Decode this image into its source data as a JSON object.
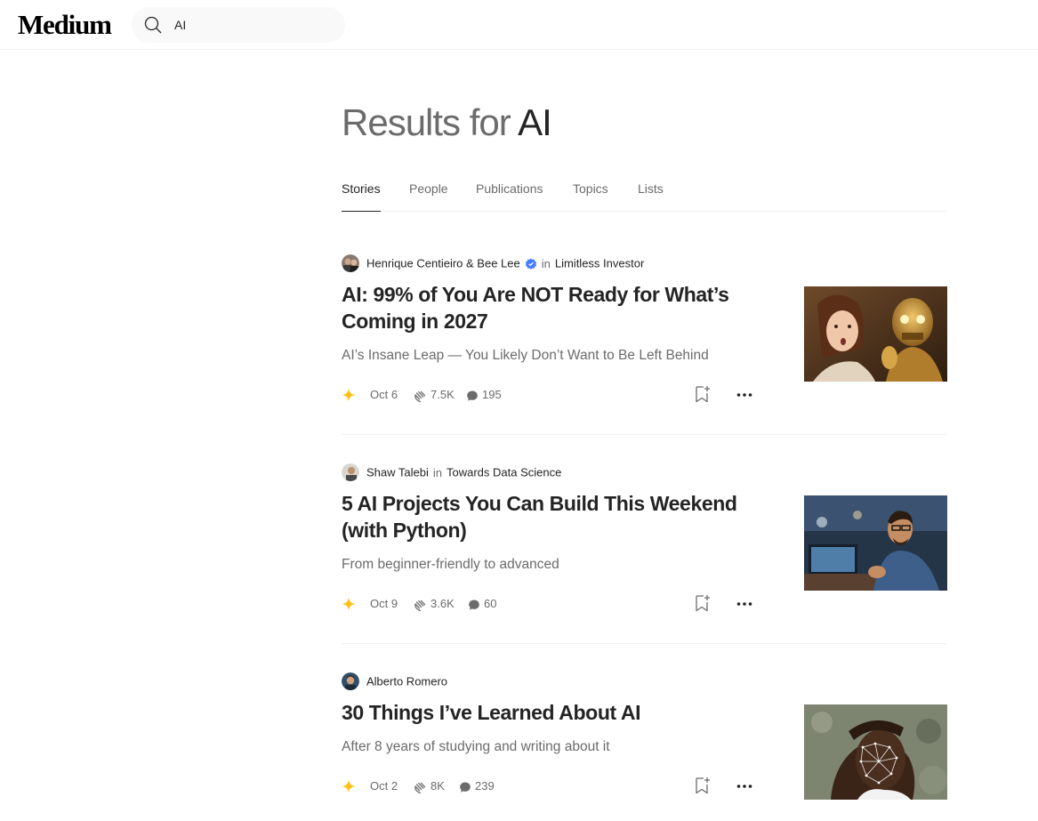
{
  "brand": {
    "logo_text": "Medium"
  },
  "search": {
    "value": "AI",
    "icon": "search-icon"
  },
  "heading": {
    "prefix": "Results for",
    "query": "AI"
  },
  "tabs": [
    {
      "label": "Stories",
      "active": true
    },
    {
      "label": "People",
      "active": false
    },
    {
      "label": "Publications",
      "active": false
    },
    {
      "label": "Topics",
      "active": false
    },
    {
      "label": "Lists",
      "active": false
    }
  ],
  "colors": {
    "accent_star": "#ffc017",
    "verified": "#437afe",
    "text": "#242424",
    "muted": "#6b6b6b",
    "divider": "#f2f2f2"
  },
  "articles": [
    {
      "authors": "Henrique Centieiro & Bee Lee",
      "verified": true,
      "in_label": "in",
      "publication": "Limitless Investor",
      "title": "AI: 99% of You Are NOT Ready for What’s Coming in 2027",
      "subtitle": "AI’s Insane Leap — You Likely Don’t Want to Be Left Behind",
      "date": "Oct 6",
      "claps": "7.5K",
      "responses": "195",
      "thumbnail": "woman-and-golden-robot-image"
    },
    {
      "authors": "Shaw Talebi",
      "verified": false,
      "in_label": "in",
      "publication": "Towards Data Science",
      "title": "5 AI Projects You Can Build This Weekend (with Python)",
      "subtitle": "From beginner-friendly to advanced",
      "date": "Oct 9",
      "claps": "3.6K",
      "responses": "60",
      "thumbnail": "man-at-computer-image"
    },
    {
      "authors": "Alberto Romero",
      "verified": false,
      "in_label": "",
      "publication": "",
      "title": "30 Things I’ve Learned About AI",
      "subtitle": "After 8 years of studying and writing about it",
      "date": "Oct 2",
      "claps": "8K",
      "responses": "239",
      "thumbnail": "face-mesh-portrait-image"
    }
  ]
}
